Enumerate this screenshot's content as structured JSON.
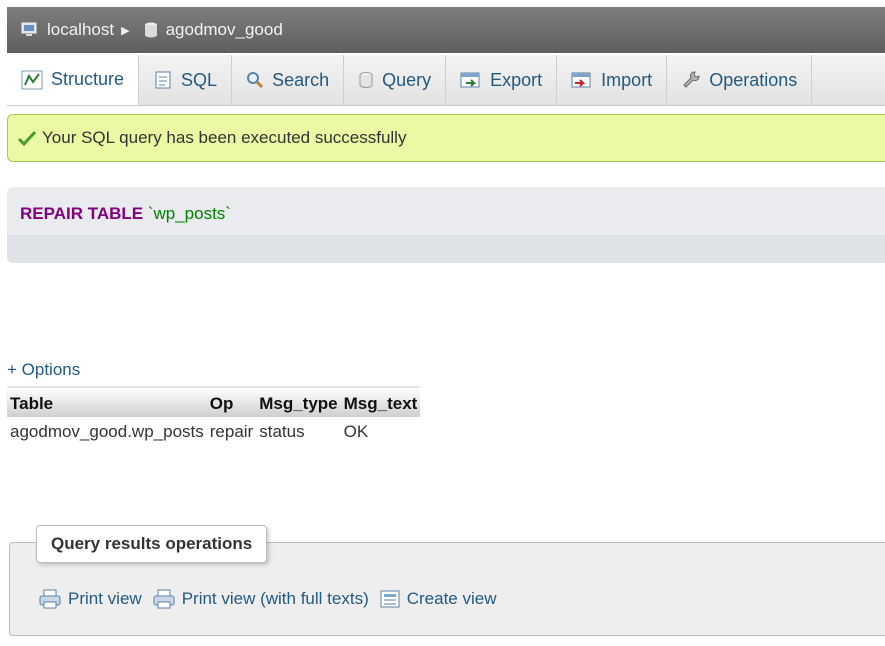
{
  "breadcrumb": {
    "server": "localhost",
    "database": "agodmov_good"
  },
  "tabs": [
    {
      "label": "Structure"
    },
    {
      "label": "SQL"
    },
    {
      "label": "Search"
    },
    {
      "label": "Query"
    },
    {
      "label": "Export"
    },
    {
      "label": "Import"
    },
    {
      "label": "Operations"
    }
  ],
  "success_message": "Your SQL query has been executed successfully",
  "sql": {
    "keyword": "REPAIR TABLE",
    "table": "`wp_posts`"
  },
  "options_label": "+ Options",
  "results": {
    "headers": [
      "Table",
      "Op",
      "Msg_type",
      "Msg_text"
    ],
    "rows": [
      [
        "agodmov_good.wp_posts",
        "repair",
        "status",
        "OK"
      ]
    ]
  },
  "query_results_operations": {
    "legend": "Query results operations",
    "actions": [
      "Print view",
      "Print view (with full texts)",
      "Create view"
    ]
  },
  "colors": {
    "success_bg": "#ebf8a4",
    "link": "#235a81",
    "keyword": "#800080",
    "string": "#008000"
  }
}
